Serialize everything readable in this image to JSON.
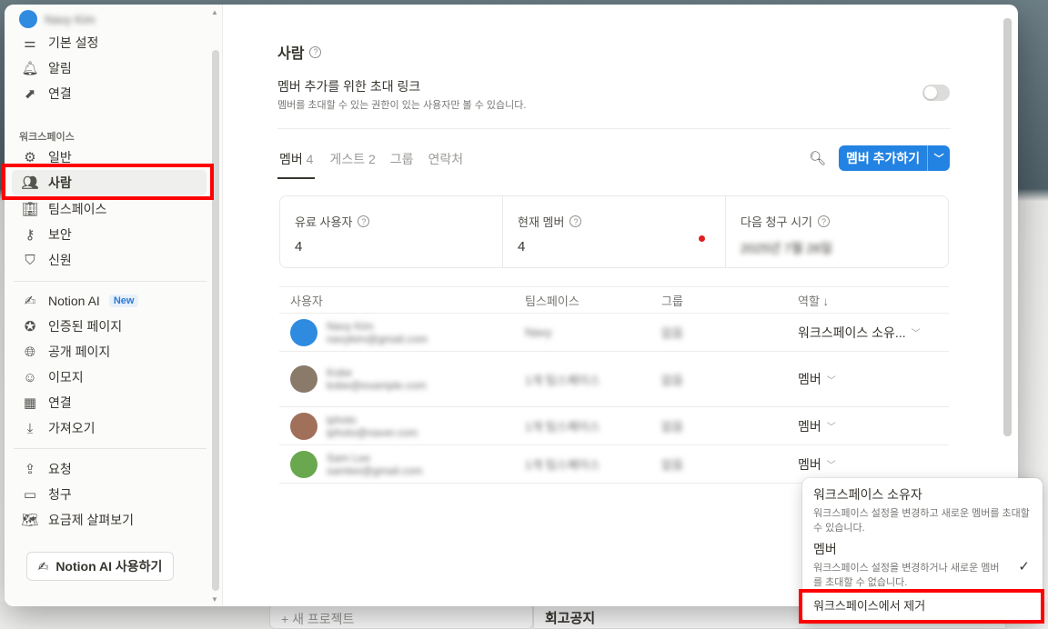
{
  "sidebar": {
    "account_name": "Navy Kim",
    "top_items": [
      "기본 설정",
      "알림",
      "연결"
    ],
    "workspace_section": "워크스페이스",
    "workspace_items": [
      "일반",
      "사람",
      "팀스페이스",
      "보안",
      "신원"
    ],
    "feature_items": [
      "Notion AI",
      "인증된 페이지",
      "공개 페이지",
      "이모지",
      "연결",
      "가져오기"
    ],
    "new_badge": "New",
    "billing_items": [
      "요청",
      "청구",
      "요금제 살펴보기"
    ],
    "ai_button": "Notion AI 사용하기"
  },
  "main": {
    "title": "사람",
    "invite_title": "멤버 추가를 위한 초대 링크",
    "invite_subtitle": "멤버를 초대할 수 있는 권한이 있는 사용자만 볼 수 있습니다.",
    "tabs": [
      {
        "label": "멤버",
        "count": "4"
      },
      {
        "label": "게스트",
        "count": "2"
      },
      {
        "label": "그룹",
        "count": ""
      },
      {
        "label": "연락처",
        "count": ""
      }
    ],
    "add_button": "멤버 추가하기",
    "cards": [
      {
        "label": "유료 사용자",
        "value": "4"
      },
      {
        "label": "현재 멤버",
        "value": "4"
      },
      {
        "label": "다음 청구 시기",
        "value": "2025년 7월 26일"
      }
    ],
    "table": {
      "headers": [
        "사용자",
        "팀스페이스",
        "그룹",
        "역할 ↓"
      ],
      "rows": [
        {
          "name": "Navy Kim",
          "email": "navykim@gmail.com",
          "teamspace": "Navy",
          "group": "없음",
          "role": "워크스페이스 소유...",
          "avatar": "#2f8be0"
        },
        {
          "name": "Kobe",
          "email": "kobe@example.com",
          "teamspace": "1개 팀스페이스",
          "group": "없음",
          "role": "멤버",
          "avatar": "#8a7a6a"
        },
        {
          "name": "iphoto",
          "email": "iphoto@naver.com",
          "teamspace": "1개 팀스페이스",
          "group": "없음",
          "role": "멤버",
          "avatar": "#a0705a"
        },
        {
          "name": "Sam Lee",
          "email": "samlee@gmail.com",
          "teamspace": "1개 팀스페이스",
          "group": "없음",
          "role": "멤버",
          "avatar": "#6aa84f"
        }
      ]
    }
  },
  "dropdown": {
    "owner_title": "워크스페이스 소유자",
    "owner_desc": "워크스페이스 설정을 변경하고 새로운 멤버를 초대할 수 있습니다.",
    "member_title": "멤버",
    "member_desc": "워크스페이스 설정을 변경하거나 새로운 멤버를 초대할 수 없습니다.",
    "remove": "워크스페이스에서 제거"
  },
  "background": {
    "new_project": "+ 새 프로젝트",
    "notice": "회고공지"
  }
}
